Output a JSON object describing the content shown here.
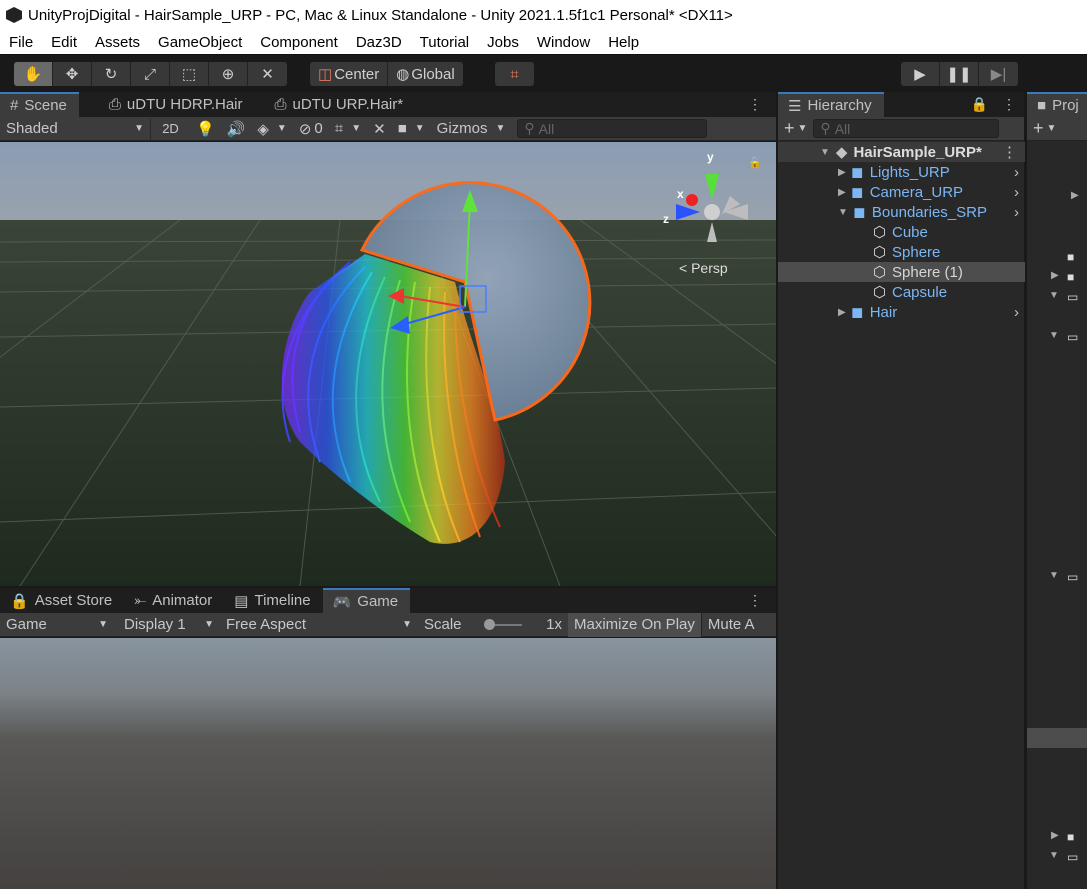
{
  "window": {
    "title": "UnityProjDigital - HairSample_URP - PC, Mac & Linux Standalone - Unity 2021.1.5f1c1 Personal* <DX11>"
  },
  "menu": [
    "File",
    "Edit",
    "Assets",
    "GameObject",
    "Component",
    "Daz3D",
    "Tutorial",
    "Jobs",
    "Window",
    "Help"
  ],
  "toolbar": {
    "pivot": "Center",
    "space": "Global"
  },
  "scene_tabs": {
    "scene": "Scene",
    "hdrp": "uDTU HDRP.Hair",
    "urp": "uDTU URP.Hair*"
  },
  "scene_bar": {
    "shading": "Shaded",
    "two_d": "2D",
    "hidden_count": "0",
    "gizmos": "Gizmos",
    "search_placeholder": "All"
  },
  "scene_view": {
    "persp": "Persp",
    "axis_y": "y",
    "axis_x": "x",
    "axis_z": "z"
  },
  "game_tabs": {
    "asset_store": "Asset Store",
    "animator": "Animator",
    "timeline": "Timeline",
    "game": "Game"
  },
  "game_bar": {
    "view": "Game",
    "display": "Display 1",
    "aspect": "Free Aspect",
    "scale_label": "Scale",
    "scale_value": "1x",
    "maximize": "Maximize On Play",
    "mute": "Mute A"
  },
  "hierarchy": {
    "tab": "Hierarchy",
    "search_placeholder": "All",
    "scene": "HairSample_URP*",
    "items": [
      {
        "label": "Lights_URP"
      },
      {
        "label": "Camera_URP"
      },
      {
        "label": "Boundaries_SRP"
      },
      {
        "label": "Cube"
      },
      {
        "label": "Sphere"
      },
      {
        "label": "Sphere (1)"
      },
      {
        "label": "Capsule"
      },
      {
        "label": "Hair"
      }
    ]
  },
  "project": {
    "tab": "Proj"
  },
  "colors": {
    "accent": "#3a79bb",
    "prefab_blue": "#7cb6f3",
    "selection_outline": "#ff6a1a"
  }
}
